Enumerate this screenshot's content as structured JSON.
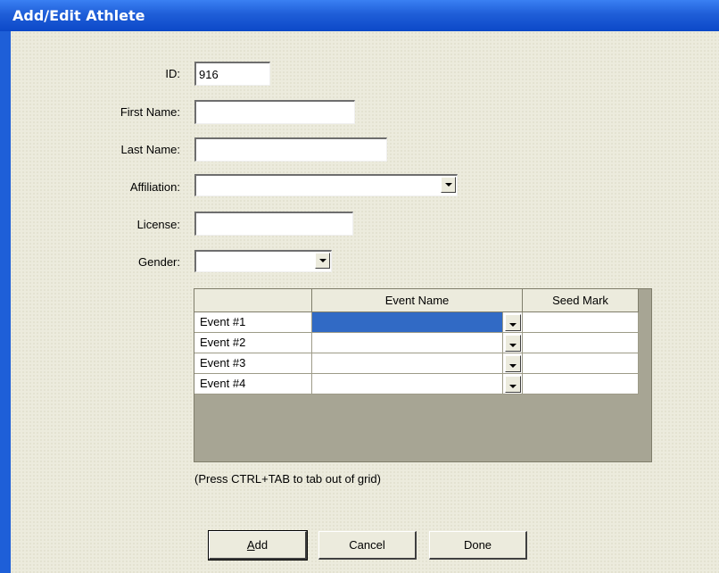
{
  "window": {
    "title": "Add/Edit Athlete"
  },
  "form": {
    "id": {
      "label": "ID:",
      "value": "916"
    },
    "first_name": {
      "label": "First Name:",
      "value": ""
    },
    "last_name": {
      "label": "Last Name:",
      "value": ""
    },
    "affiliation": {
      "label": "Affiliation:",
      "value": ""
    },
    "license": {
      "label": "License:",
      "value": ""
    },
    "gender": {
      "label": "Gender:",
      "value": ""
    }
  },
  "grid": {
    "headers": {
      "corner": "",
      "event_name": "Event Name",
      "seed_mark": "Seed Mark"
    },
    "rows": [
      {
        "label": "Event #1",
        "event_name": "",
        "seed_mark": ""
      },
      {
        "label": "Event #2",
        "event_name": "",
        "seed_mark": ""
      },
      {
        "label": "Event #3",
        "event_name": "",
        "seed_mark": ""
      },
      {
        "label": "Event #4",
        "event_name": "",
        "seed_mark": ""
      }
    ],
    "hint": "(Press CTRL+TAB to tab out of grid)"
  },
  "buttons": {
    "add_mnemonic": "A",
    "add_rest": "dd",
    "cancel": "Cancel",
    "done": "Done"
  },
  "icons": {
    "dropdown": "chevron-down-icon"
  },
  "colors": {
    "title_bar": "#0c48c8",
    "selection": "#316ac5",
    "dialog_bg": "#ecebdd"
  }
}
